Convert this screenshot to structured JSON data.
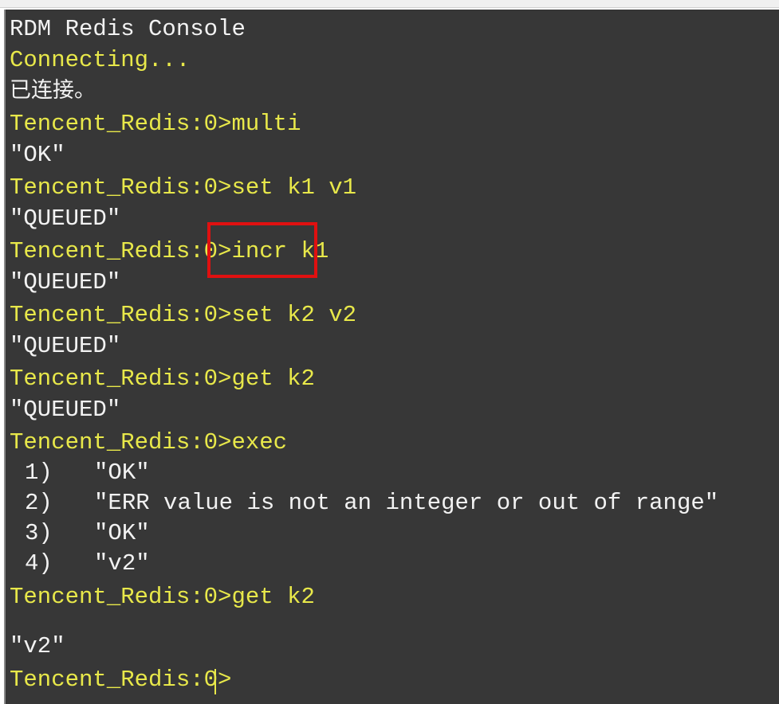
{
  "console": {
    "header": "RDM Redis Console",
    "connecting": "Connecting...",
    "connected": "已连接。",
    "prompt": "Tencent_Redis:0>",
    "lines": [
      {
        "kind": "cmd",
        "text": "multi"
      },
      {
        "kind": "out",
        "text": "\"OK\""
      },
      {
        "kind": "cmd",
        "text": "set k1 v1"
      },
      {
        "kind": "out",
        "text": "\"QUEUED\""
      },
      {
        "kind": "cmd",
        "text": "incr k1"
      },
      {
        "kind": "out",
        "text": "\"QUEUED\""
      },
      {
        "kind": "cmd",
        "text": "set k2 v2"
      },
      {
        "kind": "out",
        "text": "\"QUEUED\""
      },
      {
        "kind": "cmd",
        "text": "get k2"
      },
      {
        "kind": "out",
        "text": "\"QUEUED\""
      },
      {
        "kind": "cmd",
        "text": "exec"
      }
    ],
    "exec_results": [
      {
        "index": "1)",
        "value": "\"OK\""
      },
      {
        "index": "2)",
        "value": "\"ERR value is not an integer or out of range\""
      },
      {
        "index": "3)",
        "value": "\"OK\""
      },
      {
        "index": "4)",
        "value": "\"v2\""
      }
    ],
    "final_cmd": "get k2",
    "final_out": "\"v2\"",
    "colors": {
      "background": "#373737",
      "prompt": "#e8e84a",
      "output": "#f2f2f2",
      "highlight": "#e01010"
    }
  }
}
